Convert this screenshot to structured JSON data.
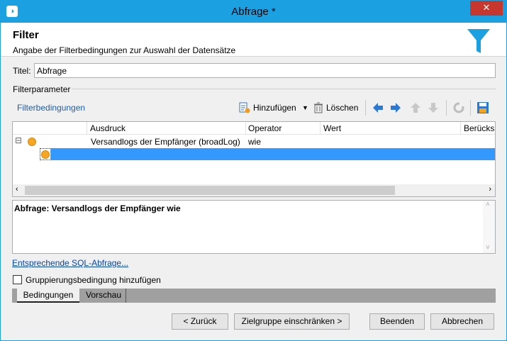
{
  "window": {
    "title": "Abfrage *",
    "close_glyph": "✕"
  },
  "header": {
    "title": "Filter",
    "subtitle": "Angabe der Filterbedingungen zur Auswahl der Datensätze"
  },
  "titel": {
    "label": "Titel:",
    "value": "Abfrage"
  },
  "section": {
    "label": "Filterparameter"
  },
  "toolbar": {
    "label": "Filterbedingungen",
    "add_label": "Hinzufügen",
    "delete_label": "Löschen"
  },
  "grid": {
    "columns": [
      "Ausdruck",
      "Operator",
      "Wert",
      "Berücks"
    ],
    "rows": [
      {
        "expand": "⊟",
        "expression": "Versandlogs der Empfänger (broadLog)",
        "operator": "wie",
        "value": ""
      }
    ]
  },
  "description": {
    "text": "Abfrage: Versandlogs der Empfänger wie"
  },
  "sql_link": "Entsprechende SQL-Abfrage...",
  "grouping": {
    "label": "Gruppierungsbedingung hinzufügen",
    "checked": false
  },
  "tabs": [
    "Bedingungen",
    "Vorschau"
  ],
  "buttons": {
    "back": "< Zurück",
    "narrow": "Zielgruppe einschränken >",
    "finish": "Beenden",
    "cancel": "Abbrechen"
  },
  "colors": {
    "accent": "#1ba1e2",
    "selection": "#3399ff",
    "close": "#c7372d",
    "dot": "#f6a623"
  }
}
